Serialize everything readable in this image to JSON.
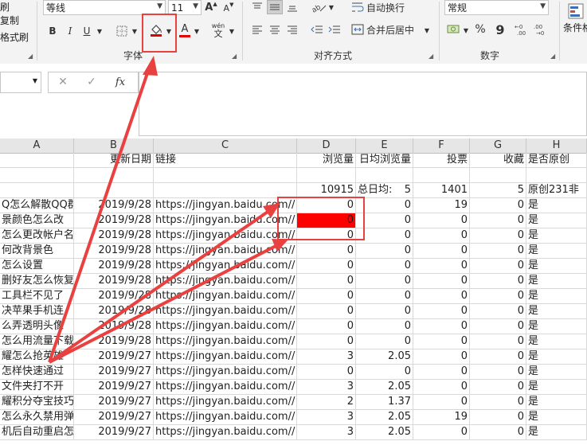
{
  "ribbon": {
    "clipboard_partial": [
      "刷",
      "复制",
      "格式刷"
    ],
    "font_name": "等线",
    "font_size": "11",
    "grow_font_label": "A",
    "shrink_font_label": "A",
    "bold": "B",
    "italic": "I",
    "underline": "U",
    "font_color_label": "A",
    "phonetic_label": "wén",
    "phonetic_sub": "文",
    "font_group": "字体",
    "wrap_text": "自动换行",
    "merge_center": "合并后居中",
    "alignment_group": "对齐方式",
    "number_format": "常规",
    "percent": "%",
    "comma": "9",
    "number_group": "数字",
    "conditional_partial": "条件格"
  },
  "formula_bar": {
    "cancel": "✕",
    "enter": "✓",
    "fx": "fx",
    "value": ""
  },
  "columns": [
    "A",
    "B",
    "C",
    "D",
    "E",
    "F",
    "G",
    "H"
  ],
  "rows": [
    {
      "a": "",
      "b": "更新日期",
      "c": "链接",
      "d": "浏览量",
      "e": "日均浏览量",
      "f": "投票",
      "g": "收藏",
      "h": "是否原创"
    },
    {
      "a": "",
      "b": "",
      "c": "",
      "d": "",
      "e": "",
      "f": "",
      "g": "",
      "h": ""
    },
    {
      "a": "",
      "b": "",
      "c": "",
      "d": "10915",
      "e": "总日均:",
      "e2": "5",
      "f": "1401",
      "g": "5",
      "h": "原创231非"
    },
    {
      "a": "Q怎么解散QQ群",
      "b": "2019/9/28",
      "c": "https://jingyan.baidu.com//",
      "d": "0",
      "e": "0",
      "f": "19",
      "g": "0",
      "h": "是"
    },
    {
      "a": "景颜色怎么改",
      "b": "2019/9/28",
      "c": "https://jingyan.baidu.com//",
      "d": "0",
      "e": "0",
      "f": "0",
      "g": "0",
      "h": "是"
    },
    {
      "a": "怎么更改帐户名",
      "b": "2019/9/28",
      "c": "https://jingyan.baidu.com//",
      "d": "0",
      "e": "0",
      "f": "0",
      "g": "0",
      "h": "是"
    },
    {
      "a": "何改背景色",
      "b": "2019/9/28",
      "c": "https://jingyan.baidu.com//",
      "d": "0",
      "e": "0",
      "f": "0",
      "g": "0",
      "h": "是"
    },
    {
      "a": "怎么设置",
      "b": "2019/9/28",
      "c": "https://jingyan.baidu.com//",
      "d": "0",
      "e": "0",
      "f": "0",
      "g": "0",
      "h": "是"
    },
    {
      "a": "删好友怎么恢复",
      "b": "2019/9/28",
      "c": "https://jingyan.baidu.com//",
      "d": "0",
      "e": "0",
      "f": "0",
      "g": "0",
      "h": "是"
    },
    {
      "a": "工具栏不见了",
      "b": "2019/9/28",
      "c": "https://jingyan.baidu.com//",
      "d": "0",
      "e": "0",
      "f": "0",
      "g": "0",
      "h": "是"
    },
    {
      "a": "决苹果手机连",
      "b": "2019/9/28",
      "c": "https://jingyan.baidu.com//",
      "d": "0",
      "e": "0",
      "f": "0",
      "g": "0",
      "h": "是"
    },
    {
      "a": "么弄透明头像",
      "b": "2019/9/28",
      "c": "https://jingyan.baidu.com//",
      "d": "0",
      "e": "0",
      "f": "0",
      "g": "0",
      "h": "是"
    },
    {
      "a": "怎么用流量下载",
      "b": "2019/9/28",
      "c": "https://jingyan.baidu.com//",
      "d": "0",
      "e": "0",
      "f": "0",
      "g": "0",
      "h": "是"
    },
    {
      "a": "耀怎么抢英雄",
      "b": "2019/9/27",
      "c": "https://jingyan.baidu.com//",
      "d": "3",
      "e": "2.05",
      "f": "0",
      "g": "0",
      "h": "是"
    },
    {
      "a": "怎样快速通过",
      "b": "2019/9/27",
      "c": "https://jingyan.baidu.com//",
      "d": "0",
      "e": "0",
      "f": "0",
      "g": "0",
      "h": "是"
    },
    {
      "a": "文件夹打不开",
      "b": "2019/9/27",
      "c": "https://jingyan.baidu.com//",
      "d": "3",
      "e": "2.05",
      "f": "0",
      "g": "0",
      "h": "是"
    },
    {
      "a": "耀积分夺宝技巧",
      "b": "2019/9/27",
      "c": "https://jingyan.baidu.com//",
      "d": "2",
      "e": "1.37",
      "f": "0",
      "g": "0",
      "h": "是"
    },
    {
      "a": "怎么永久禁用弹",
      "b": "2019/9/27",
      "c": "https://jingyan.baidu.com//",
      "d": "3",
      "e": "2.05",
      "f": "19",
      "g": "0",
      "h": "是"
    },
    {
      "a": "机后自动重启怎",
      "b": "2019/9/27",
      "c": "https://jingyan.baidu.com//",
      "d": "3",
      "e": "2.05",
      "f": "0",
      "g": "0",
      "h": "是"
    }
  ],
  "colors": {
    "annotation": "#e8413f",
    "fill_red": "#ff0000",
    "ribbon_bg": "#f3f3f3",
    "header_bg": "#e6e6e6"
  },
  "icons": [
    "fill-color-icon",
    "font-color-icon",
    "border-icon",
    "align-left-icon",
    "align-center-icon",
    "align-right-icon",
    "indent-icon",
    "wrap-icon",
    "merge-icon",
    "currency-icon",
    "decimal-icon",
    "orientation-icon",
    "cancel-icon",
    "enter-icon",
    "fx-icon"
  ]
}
